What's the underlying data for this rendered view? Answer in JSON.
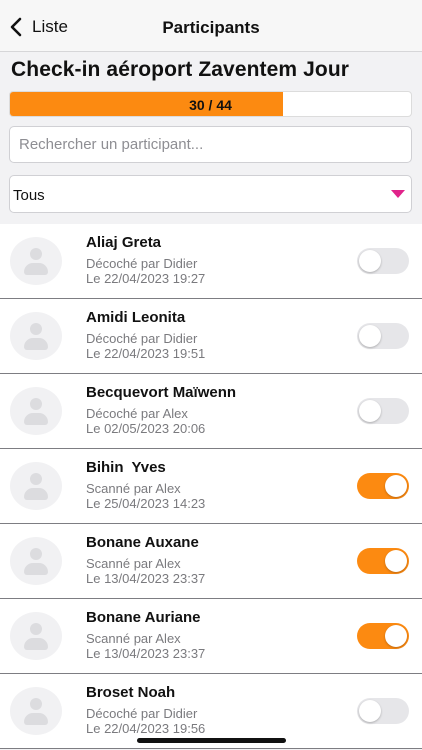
{
  "nav": {
    "back_label": "Liste",
    "title": "Participants"
  },
  "event_title": "Check-in aéroport Zaventem Jour",
  "progress": {
    "checked": 30,
    "total": 44,
    "label": "30 / 44",
    "color": "#fc8a11"
  },
  "search": {
    "placeholder": "Rechercher un participant...",
    "value": ""
  },
  "filter": {
    "selected": "Tous",
    "caret_color": "#e0238a"
  },
  "participants": [
    {
      "name": "Aliaj Greta",
      "status": "Décoché par Didier",
      "date": "Le 22/04/2023 19:27",
      "checked": false
    },
    {
      "name": "Amidi Leonita",
      "status": "Décoché par Didier",
      "date": "Le 22/04/2023 19:51",
      "checked": false
    },
    {
      "name": "Becquevort Maïwenn",
      "status": "Décoché par Alex",
      "date": "Le 02/05/2023 20:06",
      "checked": false
    },
    {
      "name": "Bihin  Yves",
      "status": "Scanné par Alex",
      "date": "Le 25/04/2023 14:23",
      "checked": true
    },
    {
      "name": "Bonane Auxane",
      "status": "Scanné par Alex",
      "date": "Le 13/04/2023 23:37",
      "checked": true
    },
    {
      "name": "Bonane Auriane",
      "status": "Scanné par Alex",
      "date": "Le 13/04/2023 23:37",
      "checked": true
    },
    {
      "name": "Broset Noah",
      "status": "Décoché par Didier",
      "date": "Le 22/04/2023 19:56",
      "checked": false
    }
  ]
}
